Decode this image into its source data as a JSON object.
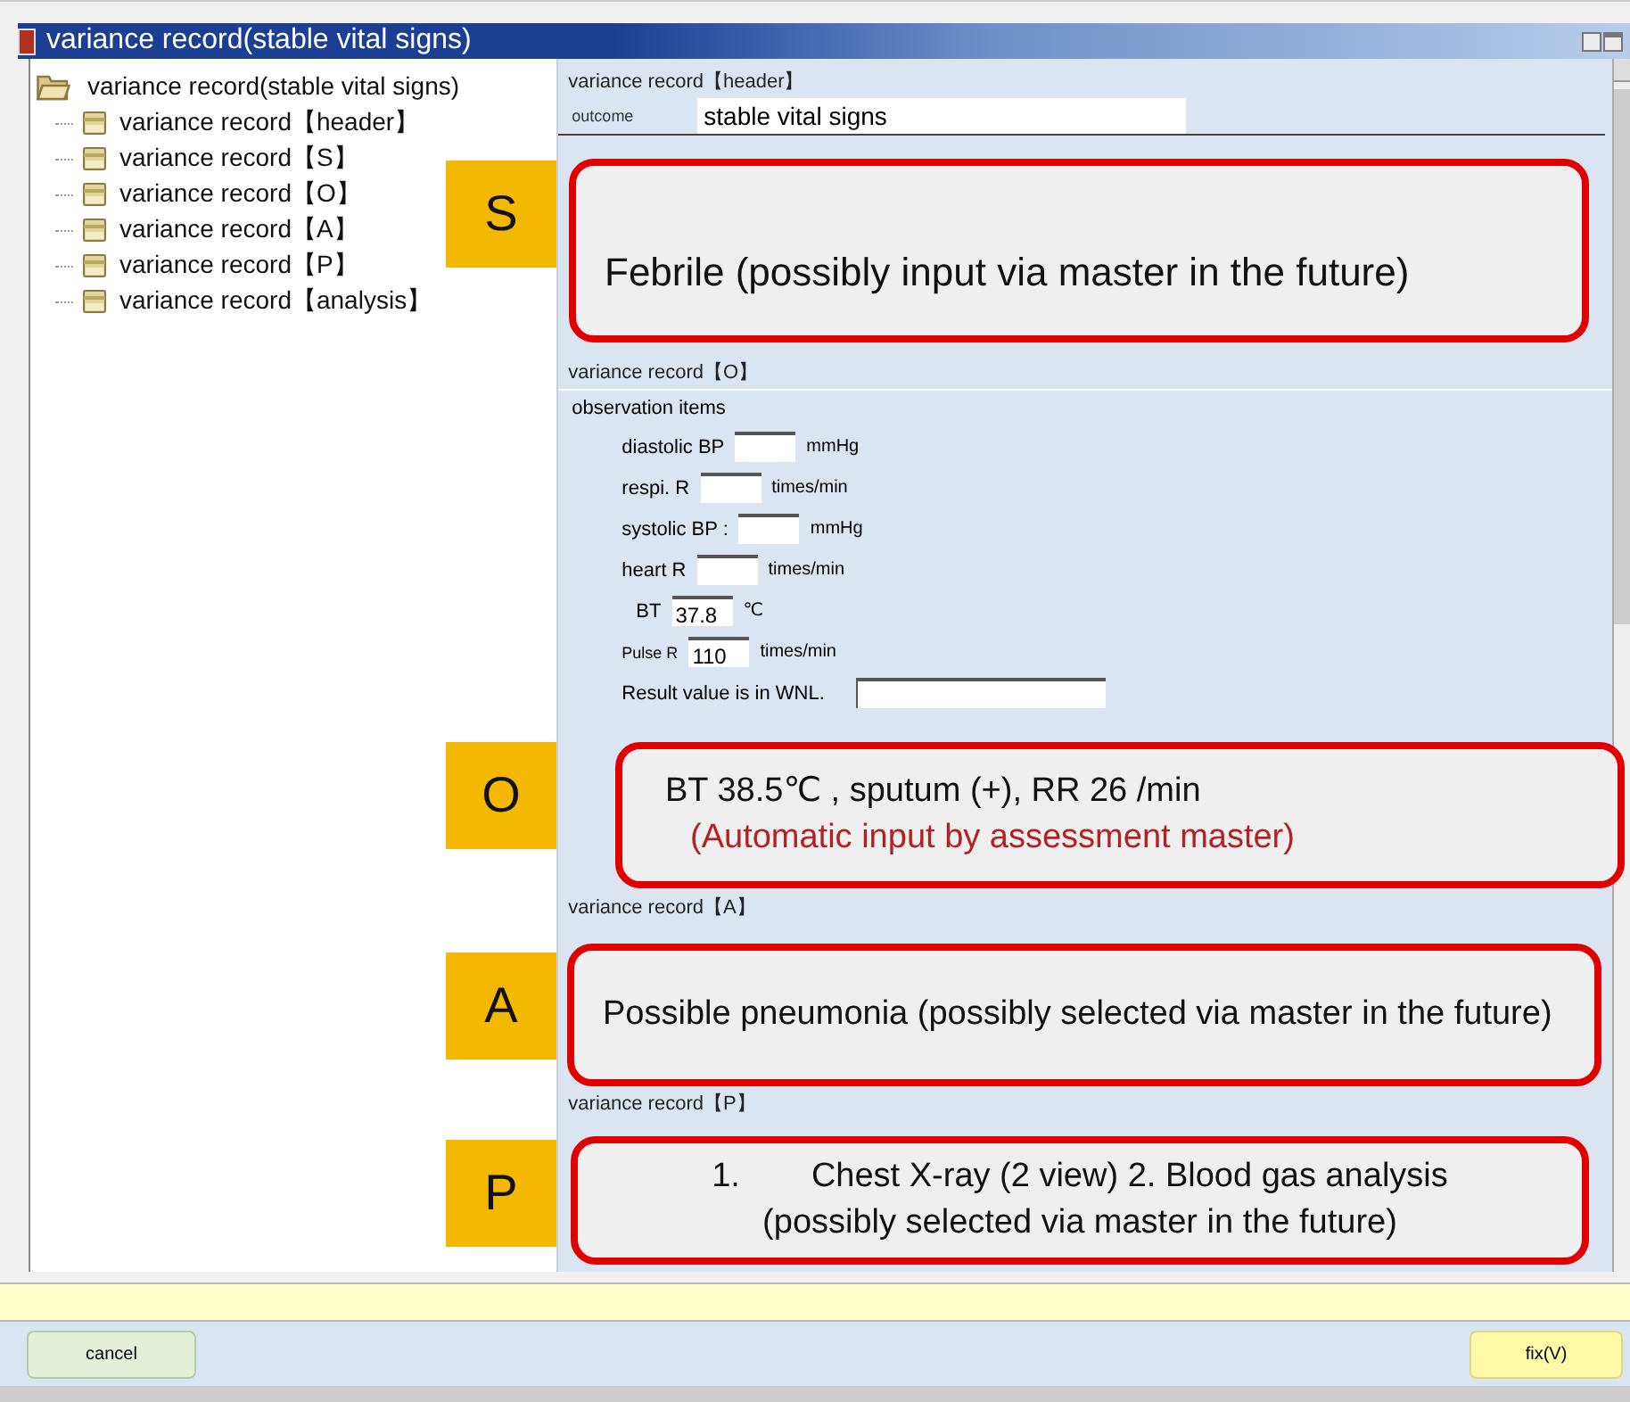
{
  "window": {
    "title": "variance record(stable vital signs)"
  },
  "tree": {
    "label": "variance record(stable vital signs)",
    "expanded": true,
    "children": [
      {
        "label": "variance record【header】"
      },
      {
        "label": "variance record【S】"
      },
      {
        "label": "variance record【O】"
      },
      {
        "label": "variance record【A】"
      },
      {
        "label": "variance record【P】"
      },
      {
        "label": "variance record【analysis】"
      }
    ]
  },
  "header": {
    "title": "variance record【header】",
    "outcome_label": "outcome",
    "outcome_value": "stable vital signs"
  },
  "o_section": {
    "title": "variance record【O】",
    "subtitle": "observation items",
    "fields": [
      {
        "label": "diastolic BP",
        "unit": "mmHg",
        "kind": "small"
      },
      {
        "label": "respi. R",
        "unit": "times/min",
        "kind": "small"
      },
      {
        "label": "systolic BP :",
        "unit": "mmHg",
        "kind": "small"
      },
      {
        "label": "heart R",
        "unit": "times/min",
        "kind": "small"
      },
      {
        "label": "BT",
        "value": "37.8",
        "unit": "℃",
        "kind": "small"
      },
      {
        "label": "Pulse R",
        "value": "110",
        "unit": "times/min",
        "kind": "small"
      },
      {
        "label": "Result value is in WNL.",
        "kind": "wide"
      }
    ]
  },
  "a_section": {
    "title": "variance record【A】"
  },
  "p_section": {
    "title": "variance record【P】"
  },
  "buttons": [
    {
      "label": "cancel",
      "kind": "cancel"
    },
    {
      "label": "fix(V)",
      "kind": "confirm"
    }
  ],
  "annotations": [
    {
      "letter": "S",
      "lines": [
        {
          "text": "Febrile (possibly input via master in the future)",
          "kind": "note"
        }
      ]
    },
    {
      "letter": "O",
      "lines": [
        {
          "text": "BT 38.5℃ , sputum (+), RR 26 /min",
          "kind": "note"
        },
        {
          "text": "(Automatic input by assessment master)",
          "kind": "auto"
        }
      ]
    },
    {
      "letter": "A",
      "lines": [
        {
          "text": "Possible pneumonia (possibly selected via master in the future)",
          "kind": "note"
        }
      ]
    },
    {
      "letter": "P",
      "lines": [
        {
          "number": "1.",
          "text": "Chest X-ray (2 view) 2. Blood gas analysis",
          "kind": "item"
        },
        {
          "text": "(possibly selected via master in the future)",
          "kind": "note"
        }
      ]
    }
  ]
}
